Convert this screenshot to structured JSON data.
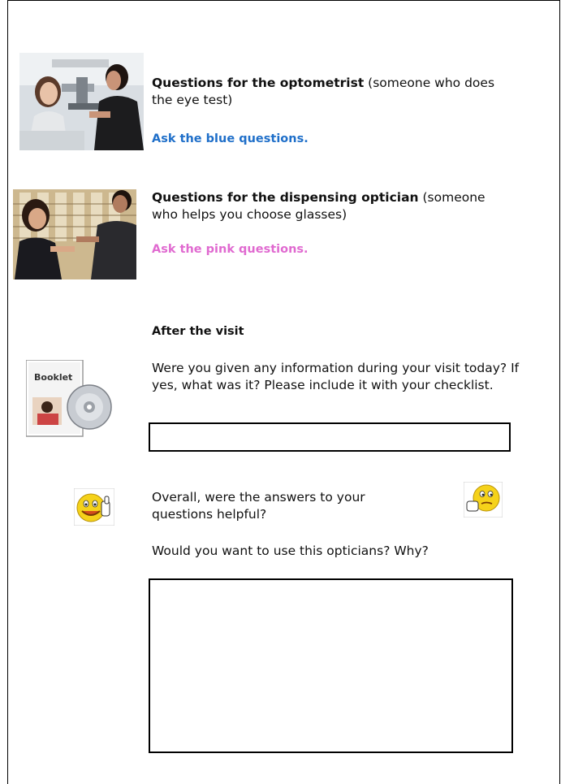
{
  "section1": {
    "heading_bold": "Questions for the optometrist",
    "heading_rest": " (someone who does the eye test)",
    "instruction": "Ask the blue questions.",
    "instruction_color": "#1f6fc9",
    "photo": "optometrist-eye-test-photo"
  },
  "section2": {
    "heading_bold": "Questions for the dispensing optician",
    "heading_rest": " (someone who helps you choose glasses)",
    "instruction": "Ask the pink questions.",
    "instruction_color": "#e06ad0",
    "photo": "choosing-glasses-photo"
  },
  "after_visit": {
    "heading": "After the visit",
    "question": "Were you given any information during your visit today?  If yes, what was it?  Please include it with your checklist.",
    "booklet_label": "Booklet",
    "answer_value": ""
  },
  "overall": {
    "question": "Overall, were the answers to your questions helpful?",
    "happy_icon": "thumbs-up-smiley-icon",
    "thinking_icon": "thinking-smiley-icon"
  },
  "use_again": {
    "question": "Would you want to use this opticians?  Why?",
    "answer_value": ""
  }
}
